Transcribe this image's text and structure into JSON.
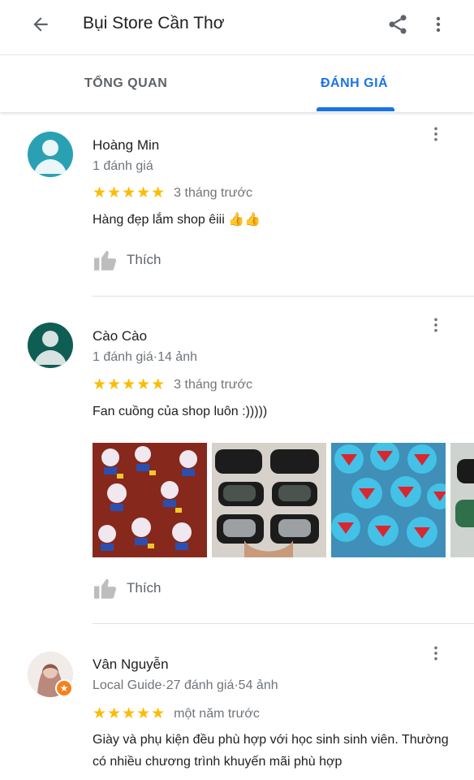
{
  "header": {
    "title": "Bụi Store Cần Thơ",
    "back_icon": "arrow-back-icon",
    "share_icon": "share-icon",
    "more_icon": "more-vert-icon"
  },
  "tabs": [
    {
      "label": "TỔNG QUAN",
      "active": false
    },
    {
      "label": "ĐÁNH GIÁ",
      "active": true
    }
  ],
  "colors": {
    "accent": "#1a73e8",
    "star": "#fbbc04",
    "secondary_text": "#70757a",
    "avatar_1": "#2aa1b3",
    "avatar_2": "#0f5e54"
  },
  "reviews": [
    {
      "author": "Hoàng Min",
      "meta": "1 đánh giá",
      "stars": "★★★★★",
      "rating": 5,
      "time": "3 tháng trước",
      "text": "Hàng đẹp lắm shop êiii 👍👍",
      "like_label": "Thích"
    },
    {
      "author": "Cào Cào",
      "meta": "1 đánh giá·14 ảnh",
      "stars": "★★★★★",
      "rating": 5,
      "time": "3 tháng trước",
      "text": "Fan cuồng của shop luôn :)))))",
      "like_label": "Thích"
    },
    {
      "author": "Vân Nguyễn",
      "meta": "Local Guide·27 đánh giá·54 ảnh",
      "stars": "★★★★★",
      "rating": 5,
      "time": "một năm trước",
      "text": "Giày và phụ kiện đều phù hợp với học sinh sinh viên. Thường có nhiều chương trình khuyến mãi phù hợp"
    }
  ]
}
